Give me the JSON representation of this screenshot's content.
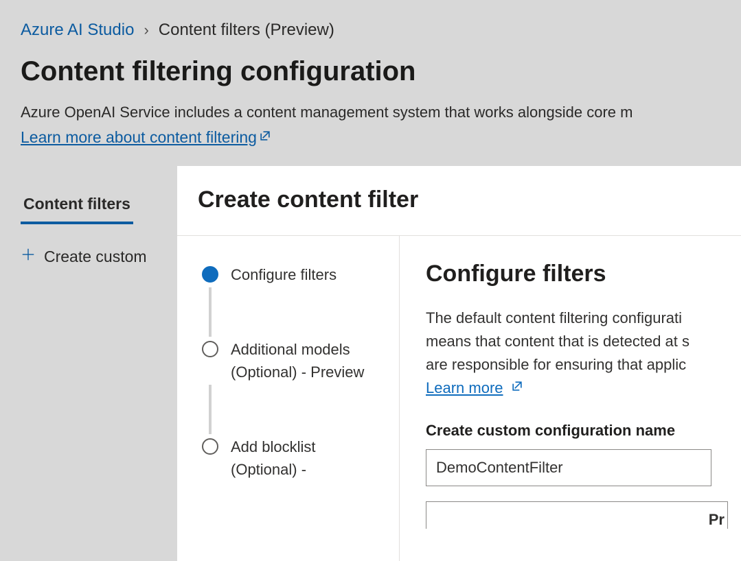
{
  "breadcrumb": {
    "root": "Azure AI Studio",
    "separator": "›",
    "current": "Content filters (Preview)"
  },
  "page": {
    "title": "Content filtering configuration",
    "description": "Azure OpenAI Service includes a content management system that works alongside core m",
    "learn_link": "Learn more about content filtering"
  },
  "tab": {
    "label": "Content filters"
  },
  "create_button": {
    "label": "Create custom"
  },
  "modal": {
    "title": "Create content filter",
    "steps": [
      {
        "label": "Configure filters",
        "active": true
      },
      {
        "label": "Additional models (Optional) - Preview",
        "active": false
      },
      {
        "label": "Add blocklist (Optional) -",
        "active": false
      }
    ],
    "content": {
      "heading": "Configure filters",
      "description_line1": "The default content filtering configurati",
      "description_line2": "means that content that is detected at s",
      "description_line3": "are responsible for ensuring that applic",
      "learn_link": "Learn more",
      "name_label": "Create custom configuration name",
      "name_value": "DemoContentFilter",
      "below_partial": "Pr"
    }
  },
  "colors": {
    "accent": "#0f6cbd"
  }
}
